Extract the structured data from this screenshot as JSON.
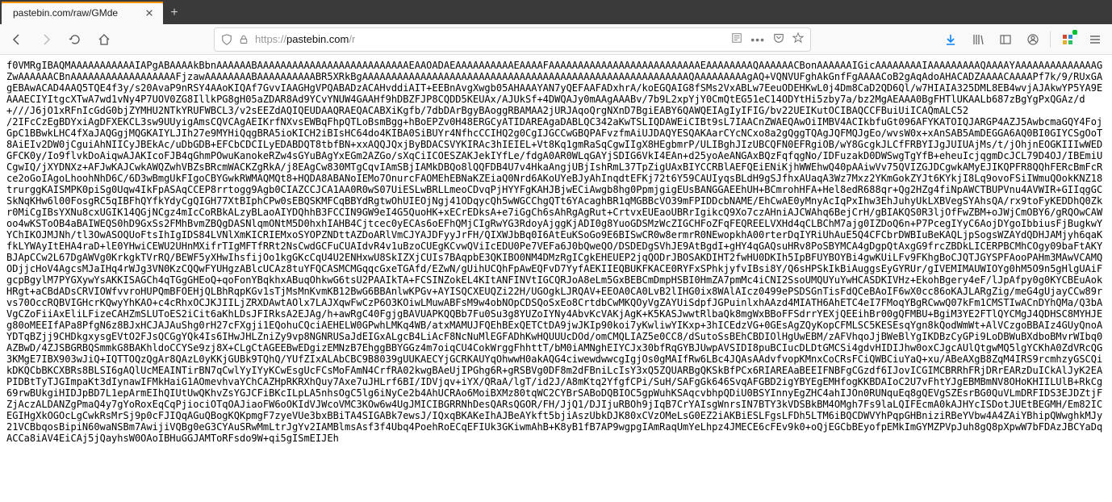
{
  "tab": {
    "title": "pastebin.com/raw/GMde"
  },
  "urlbar": {
    "scheme": "https://",
    "domain": "pastebin.com",
    "rest": "/r"
  },
  "raw_content": "f0VMRgIBAQMAAAAAAAAAAAIAPgABAAAAkBbnAAAAAABAAAAAAAAAAAAAAAAAAAAAAAAAAEAAOADAEAAAAAAAAAAEAAAAFAAAAAAAAAAAAAAAAAAAAAAAAAAEAAAAAAAAQAAAAAACBonAAAAAAIGicAAAAAAAAIAAAAAAAAAQAAAAYAAAAAAAAAAAAAAGZwAAAAAACBnAAAAAAAAAAAAAAAAAAFjzawAAAAAAAABAAAAAAAAAABR5XRkBgAAAAAAAAAAAAAAAAAAAAAAAAAAAAAAAAAAAAAAAAAAAAAAAAAAAAAAAAQAAAAAAAAAgAQ+VQNVUFghAkGnfFgAAAACoB2gAqAdoAHACADZAAAACAAAAPf7k/9/RUxGAgEBAwACAD4AAQ5TQE4f3y/s20AvaP9nRSY4AAoKIQAf7GvvIAAGHgVPQABADzACAHvddiAIT+EEBnAvgXwgb05AHAAAYAN7yQEFAAFADxhrA/koEGQAIG8fSMs2VxABLw7EeuODEHKwL0j4Dm8CaD2QD6Ql/w7HIAIA325DML8EB4wvjAJAkwYP5YA9EAAAECIYItgcXTwA7wd1vNy4P7UOV0ZG8IllkPG8gH05aZDAR8Ad9YCvYNUW4GAAHf9hDBZFJP8CQDD5KEUAx/AJUkSf+4DWQAJy0mAAgAAABv/7b9L2xpYjY0CmQtEG51eC14ODYtHi5zby7a/bz2MgAEAAA0BgFHTlUKAALb687zBgYgPxQGAz/d+///J6jO1xRFnIcGdG0bjZYMHU2NTkYRUFWBCL3/v2sEEZdAQIQEUDAAQRAEQACABXiKgfb/7dbDArBgyBAoggRBAMAA2jURJAqoQrgNXnD7BgiEABY6QAWQEIAgIyIFIG/bv22UEIKutOCIBAQCCFBuiUiICAQmALC52\n/2IFcCzEgBDYxiAgDFXEKCL3sw9UUyigAmsCQVCAgAEIKrfNXvsEWBqFhpQTLoBsmBgg+hBoEPZv0H48ERGCyATIDAREAgaDABLQC342aKwTSLIQDAWEiCIBt9sL7IAACnZWAEQAwOiIMBV4ACIkbfuGt096AFYKATOIQJARGP4AZJ5AwbcmaGQY4FojGpC1BBwkLHC4fXaJAQGgjMQGKAIYLJIh27e9MYHiQqgBRA5ioKICH2iBIsHC64do4KIBA0SiBUYr4NfhcCCIHQ2g0CgIJGCCwGBQPAFvzfmAiUJDAQYESQAKAarCYcNCxo8a2gQggTQAgJQFMQJgEo/wvsW0x+xAnSAB5AmDEGGA6AQ0BI0GIYCSgOoT8AiEIv2DW0jCguiAhNIICyJBEkAc/uDbGDB+EFCbCDCILyEDABDQT8tbfBN+xxAQQJQxjByBDACSVYKIRAc3hIEIEL+Vt8Kq1gmRaSqCgwIIgX8HEgbmrP/ULIBghJIzUBCQFN0EFRgiOB/wY8GcgkJLCfFRBYIJgJUIUAjMs/t/jOhjnEOGKIIIwWEDGFCK0y/Io9flvkDoAiqwAJAKIcoFJB4qGhmPOwuKanokeRZw4sGYuBAgYxEGm2AZGo/sXqCiICOESZAKJekIYfLe/fdgA0AR0WLqGAYjSDIG6VkI4EAn+d25yoAeANGAxBQzFqfqgNo/IDFuzakD0DWSwgTgYfB+eheuIcjqgmDcJCL79D4OJ/IBEmiUCgwIQ/jXYDNXz+AFJwKAJCwkAWQZwhVBZsBRcmWACKZgRkA/j8EAgCw830MTgCqvIAmSBjIAMkDBQo8lQQFDB4U7v4HkaAngjUBjIshRmL37TpZigUAxBIYCCRBlAEFQEiENiKjhWWEhwQ40pAAiwVv75QVIZGJDCgwkAMyEJIKQPFR8QQhFERcBmFcRce2oGoIAgoLhoohNhD6C/6D3wBmgUkFIgoCBYGwkRWMAQMQt8+HQDA8ABANoIEMo7OnurcFAOMEhEBNaKZEiaQ0Nrd6AKoUYeBJyAhInqdtEFKj72t6Y59CAUIyqsBLdH9gSJfhxAUaqA3Wz7Mxz2YKmGokZYJt6KYkjI8Lq9ovoFSiIWmuQOokKNZ18trurggKAISMPK0piSg0Uqw4IkFpASAqCCEP8rrtogg9Agb0CIAZCCJCA1AA0R0wS07UiESLwBRLLmeoCDvqPjHYYFgKAHJBjwECiAwgb8hg0PpmjgigEUsBANGGAEEhUH+BCmrohHFA+Hel8edR688qr+Qg2HZg4fiNpAWCTBUPVnu4AVWIR+GIIqgGCSkNqKHw6l00FosgRC5qIBFhQYfkYdyCgQIGH77XtBIphCPw0sEBQSKMFCqBBYdRgtwOhUIEOjNgj41ODqycQh5wWGCChgQTt6YAcaghBR1qMGBBcVO39mFPIDDcbNAME/EhCwAE0yMnyAcIqPxIhw3EhJuhyUkLXBVegSYAhsQA/rx9toFyKEDDhQ0Zkr0MiCgIBsYXNu8cxUGIK14QGjNCgz4mIcCoRBkALzyBLaoAIYDQhhB3FCCIN9GW9eI4G5QuoHK+xECrEDksA+e7iGgCh6sAhRgAgRut+CrtvxEUEaoUBRrIgikcQ9Xo7czAHniAJCWAhq6BejCrH/gBIAKQS0R3ljOfFwZBM+oJWjCmOBY6/gRQOwCAWoo4wKSToOB4aBAIWEQS0hD9GxSs2FMhBvmZBQgDASNlqmONtM5D0hxhIAHB4Cjtcec0yECAs6oEFhQMjCIgRwYG3RdoyAjggKjADI0g8YuoGDSMzWcZIGCHFoZFqFEQREELVXHd4qCLBChM7ajg0IZDoQ6n+P7PcegIYyC6AojDYgoIbbiusFjBugkwYYChIKOJMJNh/tl3OwASOQUoFtsIhIgIDS84LVNlXmKICRIEMxoSYOPZNDttAZDoARlVmCJYAJDFyyJrFH/QIXWJbBq0I6AtEuKSoGo9E6BISwCR0w8ermrR0NEwopkhA00rterDqIYRiUhAuE5Q4CFCbrDWBIuBeKAQLjpSogsWZAYdQDHJAMjyh6qaKfkLYWAyItEHA4raD+lE0YHwiCEWU2UHnMXifrTIgMFTfRRt2NsCwdGCFuCUAIdvR4v1uBzoCUEgKCvwQViIcEDU0Pe7VEFa6J0bQweQO/DSDEDgSVhJE9AtBgdI+gHY4qGAQsuHRv8PoSBYMCA4gDgpQtAxgG9frcZBDkLICERPBCMhCOgy09baFtAKYBJApCCw2L67DgAWVg0KrkgkTVrRQ/BEWF5yXHwIhsfijOo1kgGKcCqU4U2ENHxwU8SkIZXjCUIs7BAqpbE3QKIBO0NM4DMzRgICgkEHEUEP2jqQODrJBOSAKDIHT2fwHU0DKIh5IpBFUYBOYBi4gwKUiLFv9FKhgBoCJQTJGYSPFAooPAHm3MAwVCAMQODjjcHoV4AgcsMJaIHq4rWJg3VN0KzCQQwFYUHgzABlcUCAz8tuYFQCASMCMGqqcGxeTGAfd/EZwN/gUihUCQhFpAwEQFvD7YyfAEKIIEQBUKFKACE0RYFxSPhkjyfvIBsi8Y/Q6sHPSkIkBiAuggsEyGYRUr/gIVEMIMAUWIOYg0hM5O9n5gHlgUAiFgcpBgylM7PYGXywYsAKKISAGCh4qTGgGHEoQ+qoFonYBqkhxABuqOhkwG6tsU2PAAIkTA+FCSINZokEL4KItANFINVtIGCQRJoA8eLm5GxBEBCmDmpHSBI0HmZA7pmMc4iCNI2SsoUMQUYuYwHCASDKIVHz+EkohBgery4eF/lJpAfpy0g0KYCBEuAokHRgt+aCBdADsCRVIOWfvvroHUPQmBFOEHjQLBhRqpKGv1sTjMsMnKvmKB12BwG6BBAnlwKPGv+AYISQCXEUQZi22H/UGOgkLJRQAV+EEOA0CA0LvB2lIHG0ix8WAlAIcz0499ePSDSGnTisFdQCeBAoIF6wX0cc86oKAJLARgZig/meG4gUjayCCw89rvs70OccRQBVIGHcrKQwyYhKAO+c4cRhxOCJKJIILjZRXDAwtAOlx7LAJXqwFwCzP6O3KOiwLMuwABFsM9w4obNOpCDSQoSxEo8CrtdbCwMKQOyVgZAYUiSdpfJGPuinlxhAAzd4MIATH6AhETC4eI7FMoqYBgRCwwQ07kFm1CMSTIwACnDYhQMa/Q3bAVgCZoFiiAxEliLFizeCAHZmSLUToES2iCit6aKhLDsJFIRksA2EJAg/h+awRgC40FgjgBAVUAPKQQBb7Fu0Su3g8YUZoIYNy4AbvKcVAKjAgK+K5KASJwwtRlbaQk8mgWxBBoFFSdrrYEXjQEEihBr00gQFMBU+BgiM3YE2FTlQYCMgJ4QDHSC8MYHJEg80oMEEIfAPa8PfgN6z8BJxHCJAJAuShg0rH27cFXgji1EQohuCQciAEHELW0GPwhLMKq4WB/atxMAMUJFQEhBExQETCtDA9jwJKIp90koi7yKwliwYIKxp+3hICEdzVG+0GEsAgZQyKopCFMLSC5KESEsqYgn8kQodWmWt+AlVCzgoBBAIz4GUyQnoAYDTqBZjj9CHDkgxysgEVtO2FJsQCGgYQk4Is6IHwJHLZniZy9vp8NGNRUSaJdEIGxALgcB4LiAcF8NcNuMlEGFADhKwHQUUUcDOd/omCMQLIAZ5e0CC8/dSutoSsBEhCBDIOlHgUwEBM/zAFVhqoJjBWeBlYgIKDBzCyGPi9LoDBWuBXdboBMvrWIbq0AZBwD/4ZJSBGRBQSmmkG8BAKhldoCCYSe9zj8X+CLgCtAGEEBwEDgizEMNzB7EhggBBYGGz4m7oiqCU4CokWrggFhhttT/bM0iAMNghEIYCJx30bfRqGYBJUwpAVSIDI8puBCIucDLDtGMCSi4gdvHIDIJhw0oxCJgcAUlQtgwMQ5lgYCKhA0ZdVRcQG3KMgE7IBX903wJiQ+IQTTOQzQgAr8QAzL0yKKjGUBk9TQhQ/YUfZIxALAbCBC9B8039gUUKAECYjGCRKAUYqOhwwH0akAQG4ciwewdwwcgIgjOs0gMAIfRw6LBc4JQAsAAdvfvopKMnxCoCRsFCiQWBCiuYaQ+xu/ABeAXgB8ZqM4IRS9rcmhzyGSCQikDKQCbBKCXBRs8BLSI6gAQlUcMEAINTirBN7qCwlYyIYyKCwEsgUcFCsMoFAmN4CrfRA02kwgBAeUjIPGhg6R+gRSBVg0DF8m2dFBniLcIsY3xQ5ZQUARBgQKSkBfPCx6RIAREAaBEEIFNBFgCGzdf6IJovICGIMCBRRhFRjDRrEARzDuICkAlJyK2EAPIDBtTyTJGImpaKt3dIynawIFMkHaiG1AOmevhvaYChCAZHpRKRXhQuy7Axe7uJHLrf6BI/IDVjqv+iYX/QRaA/lgT/id2J/A8mKtq2YfgfCPi/SuH/SAFgGk646SvqAFGBD2igYBYEgEMHfogKKBDAIoC2U7vFhtYJgEBMBmNV8OHoKHIILUlB+RkCg69rwBUkgiHIDJpBD7L1epArmEIhQIUtUwQKhvZsYGJCFiBKcILpLA5nhsOgC5lg6iNyCe2b4AhUCRAo6MoiBXMz80tqWC2CYBrSABoDQBIOC5gpWuhKSAqcvbhpQDiU0BSYInnyEgZHC4ahIJOn0RUNquEq8gQEVgSZEsrBG0QuVLmDRFIDS3EJDZtjFZjAczALDANZgPmaQ4y7gYoRoxEqCqPjiociOTqOAJiaoFW6oOKIdVJWcoVMC3KOw6w4UgJMICIBGRRNhDesQARsQGOR/FH/JjQ1/DJIjuRBOh9jIqB7CrYAIsgWnrsIN7BTY3kVDSBkBM4OMgh7Fs9laLQIFEcmA0kAJHYcISDotJUEtBEGMH/Em82ICEGIHgXkOGOcLgCwkRsMrSj9p0cFJIQqAGuQBogKQKpmgF7zyeVUe3bxBBiTA4SIGABk7ewsJ/IQxqBKAKeIhAJBeAYkft5bjiAszUbkDJK80xCVzOMeLsG0EZ2iAKBiESLFgsLFDh5LTM6iBQCDWVYhPqpGHBniziRBeYVbw4A4ZAiYBhipQWwghkMJy21VCBbqosBipiN60waNSBm7AwijiVQBg0eG3CYAuSRwMmLtrJgYv2IAMBlmsAsf3f4Ubq4PoehRoECqEFIUk3GKiwmAhB+K8yB1fB7AP9wgpgIAmRaqUmYeLhpz4JMECE6cFEv9k0+oQjEGCbBEyofpEMkImGYMZPVpJuh8gQ8pXpwW7bFDAzJBCYaDqACCa8iAV4EiCAj5jQayhsW0OAoIBHuGGJAMToRFsdo9W+qi5gISmEIJEh"
}
